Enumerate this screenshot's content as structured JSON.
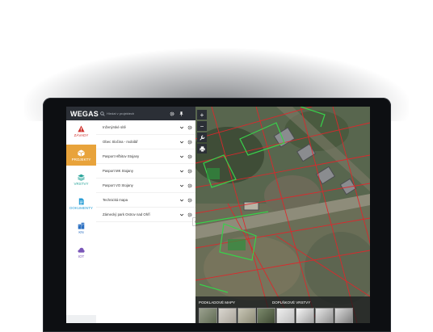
{
  "app": {
    "logo_text": "WEGAS",
    "search_placeholder": "Hledat v projektech"
  },
  "nav": [
    {
      "id": "zavady",
      "label": "ZÁVADY",
      "icon": "warning-icon"
    },
    {
      "id": "projekty",
      "label": "PROJEKTY",
      "icon": "box-icon",
      "active": true
    },
    {
      "id": "vrstvy",
      "label": "VRSTVY",
      "icon": "layers-icon"
    },
    {
      "id": "dokumenty",
      "label": "DOKUMENTY",
      "icon": "document-icon"
    },
    {
      "id": "kn",
      "label": "KN",
      "icon": "buildings-icon"
    },
    {
      "id": "iot",
      "label": "IOT",
      "icon": "cloud-icon"
    }
  ],
  "projects": [
    {
      "name": "Inženýrské sítě"
    },
    {
      "name": "Obec Sločina - mobilář"
    },
    {
      "name": "Pasport Hřbitov Stojany"
    },
    {
      "name": "Pasport MK Stojany"
    },
    {
      "name": "Pasport VO Stojany"
    },
    {
      "name": "Technická mapa"
    },
    {
      "name": "Zámecký park Ostrov nad Ohří"
    }
  ],
  "map": {
    "bottom_panel": {
      "base_maps_label": "PODKLADOVÉ MAPY",
      "extra_layers_label": "DOPLŇKOVÉ VRSTVY"
    }
  },
  "colors": {
    "topbar": "#2b2f36",
    "active_nav": "#e8a33b",
    "parcel_red": "#e0262b",
    "parcel_green": "#38d14a"
  }
}
